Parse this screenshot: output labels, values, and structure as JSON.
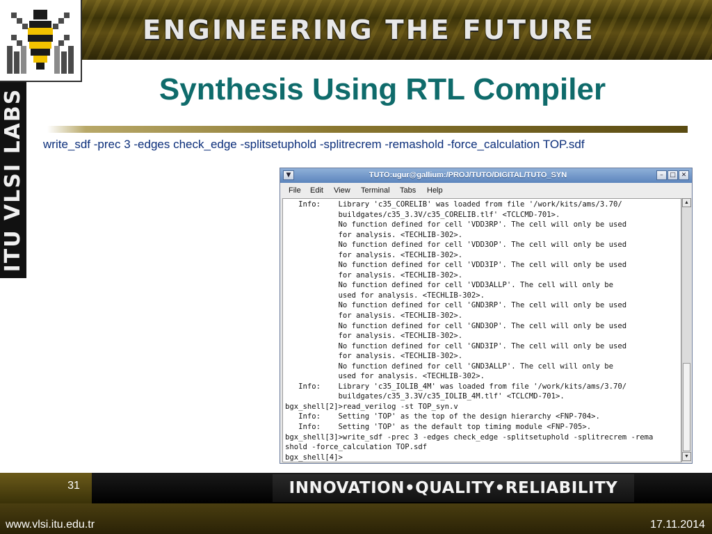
{
  "header": {
    "slogan": "ENGINEERING THE FUTURE",
    "side_label": "ITU VLSI LABS"
  },
  "slide": {
    "title": "Synthesis Using RTL Compiler",
    "command": "write_sdf -prec 3 -edges check_edge -splitsetuphold -splitrecrem -remashold -force_calculation TOP.sdf"
  },
  "terminal": {
    "title": "TUTO:ugur@gallium:/PROJ/TUTO/DIGITAL/TUTO_SYN",
    "menu": [
      "File",
      "Edit",
      "View",
      "Terminal",
      "Tabs",
      "Help"
    ],
    "lines": [
      "   Info:    Library 'c35_CORELIB' was loaded from file '/work/kits/ams/3.70/",
      "            buildgates/c35_3.3V/c35_CORELIB.tlf' <TCLCMD-701>.",
      "            No function defined for cell 'VDD3RP'. The cell will only be used",
      "            for analysis. <TECHLIB-302>.",
      "            No function defined for cell 'VDD3OP'. The cell will only be used",
      "            for analysis. <TECHLIB-302>.",
      "            No function defined for cell 'VDD3IP'. The cell will only be used",
      "            for analysis. <TECHLIB-302>.",
      "            No function defined for cell 'VDD3ALLP'. The cell will only be",
      "            used for analysis. <TECHLIB-302>.",
      "            No function defined for cell 'GND3RP'. The cell will only be used",
      "            for analysis. <TECHLIB-302>.",
      "            No function defined for cell 'GND3OP'. The cell will only be used",
      "            for analysis. <TECHLIB-302>.",
      "            No function defined for cell 'GND3IP'. The cell will only be used",
      "            for analysis. <TECHLIB-302>.",
      "            No function defined for cell 'GND3ALLP'. The cell will only be",
      "            used for analysis. <TECHLIB-302>.",
      "   Info:    Library 'c35_IOLIB_4M' was loaded from file '/work/kits/ams/3.70/",
      "            buildgates/c35_3.3V/c35_IOLIB_4M.tlf' <TCLCMD-701>.",
      "bgx_shell[2]>read_verilog -st TOP_syn.v",
      "   Info:    Setting 'TOP' as the top of the design hierarchy <FNP-704>.",
      "   Info:    Setting 'TOP' as the default top timing module <FNP-705>.",
      "bgx_shell[3]>write_sdf -prec 3 -edges check_edge -splitsetuphold -splitrecrem -rema",
      "shold -force_calculation TOP.sdf",
      "bgx_shell[4]>"
    ]
  },
  "footer": {
    "page_number": "31",
    "slogan": "INNOVATION•QUALITY•RELIABILITY",
    "url": "www.vlsi.itu.edu.tr",
    "date": "17.11.2014"
  },
  "colors": {
    "title": "#0f6b6b",
    "command_text": "#0b2e7a",
    "banner_gold": "#6b5a1a"
  },
  "icons": [
    "bee-logo-icon",
    "menu-icon",
    "minimize-icon",
    "maximize-icon",
    "close-icon",
    "scroll-up-icon",
    "scroll-down-icon"
  ]
}
